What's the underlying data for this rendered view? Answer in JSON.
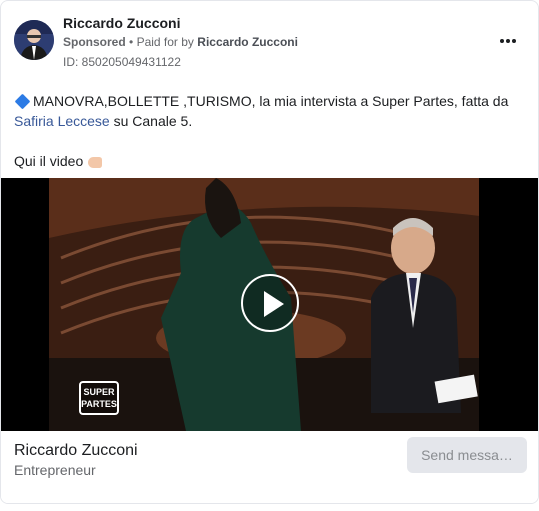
{
  "ad": {
    "advertiser_name": "Riccardo Zucconi",
    "sponsored_label": "Sponsored",
    "separator": "•",
    "paid_for_prefix": "Paid for by",
    "paid_for_name": "Riccardo Zucconi",
    "ad_id_text": "ID: 850205049431122"
  },
  "body": {
    "line1_text": "MANOVRA,BOLLETTE ,TURISMO, la mia intervista a Super Partes, fatta da",
    "link_text": "Safiria Leccese",
    "line2_rest": " su Canale 5.",
    "line3_text": "Qui il video"
  },
  "media": {
    "logo_line1": "SUPER",
    "logo_line2": "PARTES"
  },
  "footer": {
    "title": "Riccardo Zucconi",
    "subtitle": "Entrepreneur",
    "cta_label": "Send messa…"
  },
  "icons": {
    "more": "more-options-icon",
    "play": "play-icon",
    "bullet": "blue-diamond-icon",
    "hand": "pointing-down-hand-icon"
  }
}
